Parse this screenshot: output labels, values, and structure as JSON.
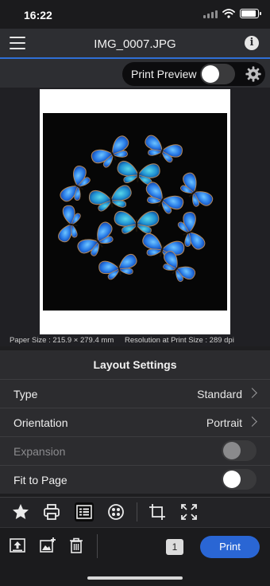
{
  "status_bar": {
    "time": "16:22"
  },
  "nav": {
    "title": "IMG_0007.JPG",
    "menu_icon": "hamburger-icon",
    "info_icon": "info-icon"
  },
  "preview": {
    "label": "Print Preview",
    "enabled": false,
    "settings_icon": "gear-icon"
  },
  "paper_info": {
    "paper_size": "Paper Size : 215.9 × 279.4 mm",
    "resolution": "Resolution at Print Size : 289 dpi"
  },
  "layout_settings": {
    "header": "Layout Settings",
    "rows": [
      {
        "label": "Type",
        "value": "Standard",
        "kind": "disclosure"
      },
      {
        "label": "Orientation",
        "value": "Portrait",
        "kind": "disclosure"
      },
      {
        "label": "Expansion",
        "kind": "toggle",
        "on": false,
        "disabled": true
      },
      {
        "label": "Fit to Page",
        "kind": "toggle",
        "on": false,
        "disabled": false
      }
    ]
  },
  "toolbar": {
    "icons": [
      "star-icon",
      "printer-icon",
      "layout-settings-icon",
      "color-palette-icon",
      "crop-icon",
      "expand-icon"
    ],
    "active": "layout-settings-icon"
  },
  "bottom_bar": {
    "icons": [
      "upload-icon",
      "add-photo-icon",
      "trash-icon"
    ],
    "copies": "1",
    "print_label": "Print"
  },
  "colors": {
    "accent": "#2f6fd6",
    "print_button": "#2a66d4",
    "butterfly": "#2f7be6"
  }
}
